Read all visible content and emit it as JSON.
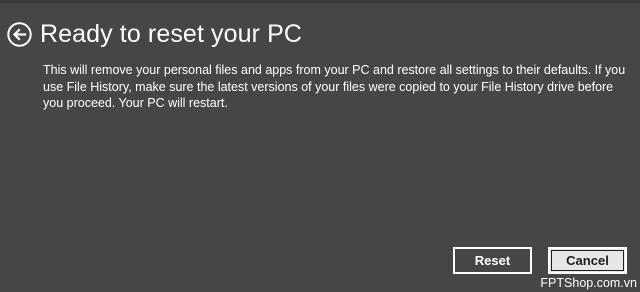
{
  "header": {
    "back_icon": "back-arrow-circle-icon",
    "title": "Ready to reset your PC"
  },
  "content": {
    "description": "This will remove your personal files and apps from your PC and restore all settings to their defaults. If you use File History, make sure the latest versions of your files were copied to your File History drive before you proceed. Your PC will restart."
  },
  "actions": {
    "reset_label": "Reset",
    "cancel_label": "Cancel"
  },
  "watermark": {
    "text": "FPTShop.com.vn"
  },
  "colors": {
    "background": "#464646",
    "text": "#ffffff",
    "cancel_background": "#e6e6e6"
  }
}
